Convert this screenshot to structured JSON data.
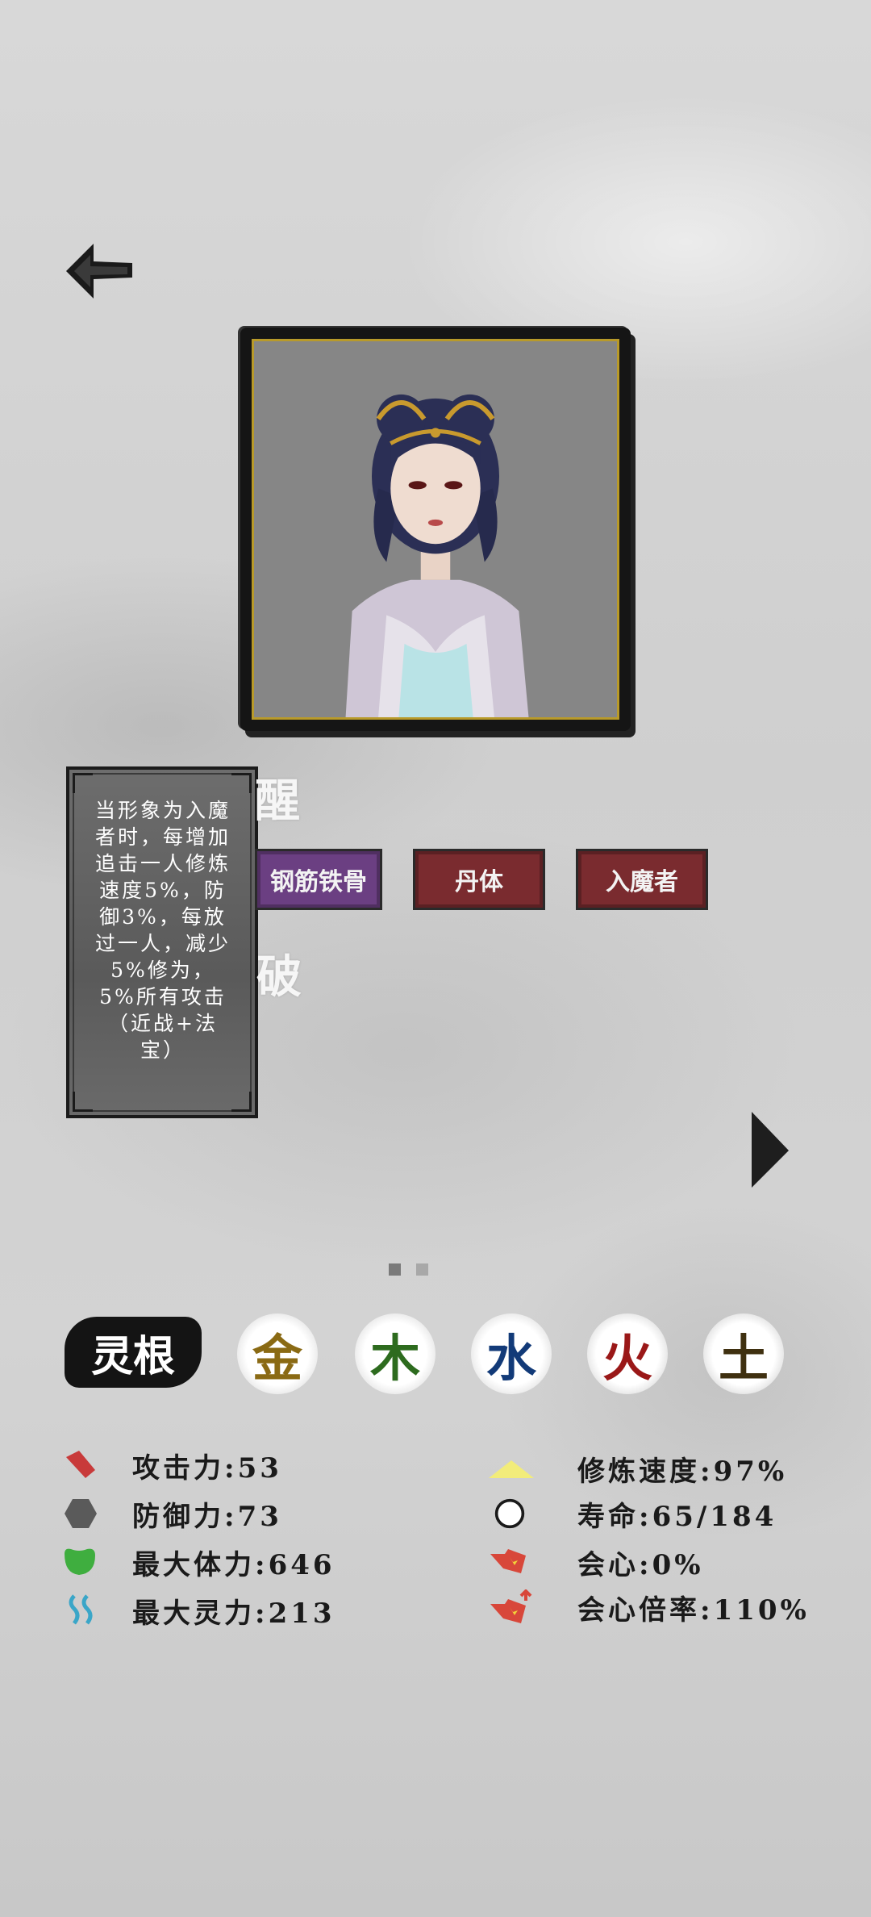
{
  "tooltip": {
    "text": "当形象为入魔者时，每增加追击一人修炼速度5%，防御3%，每放过一人，减少5%修为，5%所有攻击（近战+法宝）"
  },
  "side_chars": [
    "醒",
    "破"
  ],
  "traits": [
    "钢筋铁骨",
    "丹体",
    "入魔者"
  ],
  "linggen": {
    "label": "灵根",
    "elements": [
      {
        "char": "金",
        "color": "#8a6a14"
      },
      {
        "char": "木",
        "color": "#2d6b1e"
      },
      {
        "char": "水",
        "color": "#123a78"
      },
      {
        "char": "火",
        "color": "#9a1818"
      },
      {
        "char": "土",
        "color": "#3f3010"
      }
    ]
  },
  "stats": {
    "left": [
      {
        "icon": "attack-icon",
        "label": "攻击力",
        "value": "53"
      },
      {
        "icon": "defense-icon",
        "label": "防御力",
        "value": "73"
      },
      {
        "icon": "health-icon",
        "label": "最大体力",
        "value": "646"
      },
      {
        "icon": "spirit-icon",
        "label": "最大灵力",
        "value": "213"
      }
    ],
    "right": [
      {
        "icon": "cultivation-speed-icon",
        "label": "修炼速度",
        "value": "97%"
      },
      {
        "icon": "lifespan-icon",
        "label": "寿命",
        "value": "65/184"
      },
      {
        "icon": "critical-icon",
        "label": "会心",
        "value": "0%"
      },
      {
        "icon": "critical-multiplier-icon",
        "label": "会心倍率",
        "value": "110%"
      }
    ]
  },
  "colors": {
    "attack": "#c83a3a",
    "defense": "#5a5a5a",
    "health": "#3fae3f",
    "spirit": "#3aa6c8",
    "speed": "#f2ec7a",
    "trait_purple": "#6b3f82",
    "trait_red": "#7a2b2f"
  }
}
